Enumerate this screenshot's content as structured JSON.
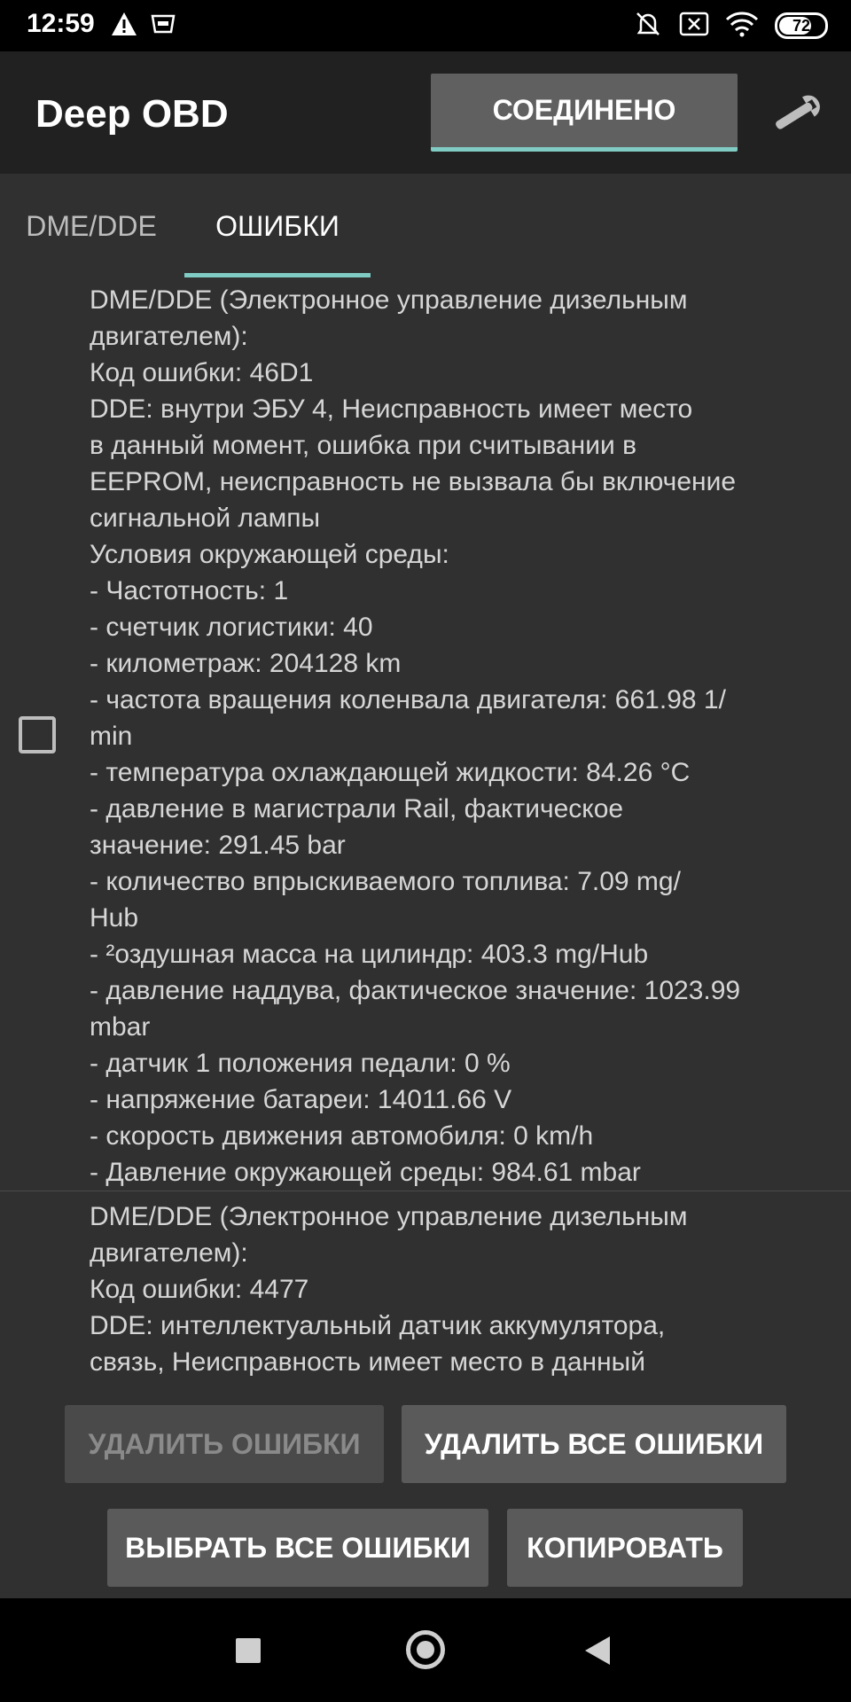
{
  "status_bar": {
    "time": "12:59",
    "icons_left": [
      "warning-icon",
      "obd-icon"
    ],
    "icons_right": [
      "mute-icon",
      "sim-off-icon",
      "wifi-icon"
    ],
    "battery": "72",
    "battery_level": 0.72
  },
  "app_bar": {
    "title": "Deep OBD",
    "connect_label": "СОЕДИНЕНО",
    "settings_icon": "wrench-icon"
  },
  "tabs": [
    {
      "label": "DME/DDE",
      "selected": false
    },
    {
      "label": "ОШИБКИ",
      "selected": true
    }
  ],
  "errors": [
    {
      "checked": false,
      "lines": [
        "DME/DDE (Электронное управление дизельным",
        "двигателем):",
        "Код ошибки: 46D1",
        "DDE: внутри ЭБУ 4, Неисправность имеет место",
        "в данный момент, ошибка при считывании в",
        "EEPROM, неисправность не вызвала бы включение",
        "сигнальной лампы",
        "Условия окружающей среды:",
        "- Частотность: 1",
        "- счетчик логистики: 40",
        "- километраж: 204128 km",
        "- частота вращения коленвала двигателя: 661.98 1/",
        "min",
        "- температура охлаждающей жидкости: 84.26 °C",
        "- давление в магистрали Rail, фактическое",
        "значение: 291.45 bar",
        "- количество впрыскиваемого топлива: 7.09 mg/",
        "Hub",
        "- ²оздушная масса на цилиндр: 403.3 mg/Hub",
        "- давление наддува, фактическое значение: 1023.99",
        "mbar",
        "- датчик 1 положения педали: 0 %",
        "- напряжение батареи: 14011.66 V",
        "- скорость движения автомобиля: 0 km/h",
        "- Давление окружающей среды: 984.61 mbar"
      ]
    },
    {
      "lines": [
        "DME/DDE (Электронное управление дизельным",
        "двигателем):",
        "Код ошибки: 4477",
        "DDE: интеллектуальный датчик аккумулятора,",
        "связь, Неисправность имеет место в данный"
      ]
    }
  ],
  "buttons": {
    "delete_errors": "УДАЛИТЬ ОШИБКИ",
    "delete_all_errors": "УДАЛИТЬ ВСЕ ОШИБКИ",
    "select_all_errors": "ВЫБРАТЬ ВСЕ ОШИБКИ",
    "copy": "КОПИРОВАТЬ"
  },
  "nav_bar": {
    "icons": [
      "recents-icon",
      "home-icon",
      "back-icon"
    ]
  }
}
